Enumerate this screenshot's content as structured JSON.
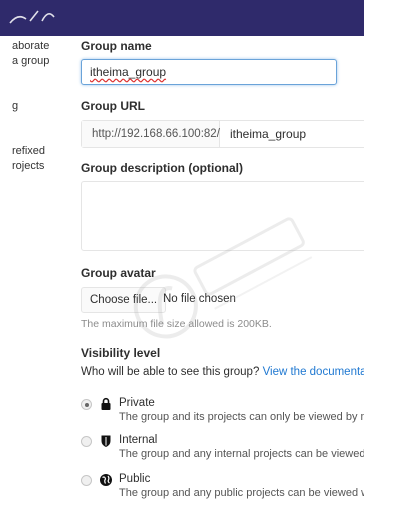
{
  "left_col": {
    "lines": [
      "aborate",
      "a group",
      "g",
      "refixed",
      "rojects"
    ]
  },
  "form": {
    "group_name_label": "Group name",
    "group_name_value": "itheima_group",
    "group_url_label": "Group URL",
    "url_prefix": "http://192.168.66.100:82/",
    "url_value": "itheima_group",
    "description_label": "Group description (optional)",
    "avatar_label": "Group avatar",
    "choose_file_label": "Choose file...",
    "no_file_text": "No file chosen",
    "avatar_help": "The maximum file size allowed is 200KB.",
    "visibility_label": "Visibility level",
    "visibility_question": "Who will be able to see this group?",
    "visibility_link": "View the documentatio"
  },
  "visibility_options": [
    {
      "title": "Private",
      "description": "The group and its projects can only be viewed by m",
      "icon": "lock-icon",
      "checked": true
    },
    {
      "title": "Internal",
      "description": "The group and any internal projects can be viewed",
      "icon": "shield-icon",
      "checked": false
    },
    {
      "title": "Public",
      "description": "The group and any public projects can be viewed w",
      "icon": "globe-icon",
      "checked": false
    }
  ],
  "colors": {
    "topbar": "#2f2a6b",
    "link": "#1f78d1",
    "focus_border": "#6aa3d9"
  }
}
